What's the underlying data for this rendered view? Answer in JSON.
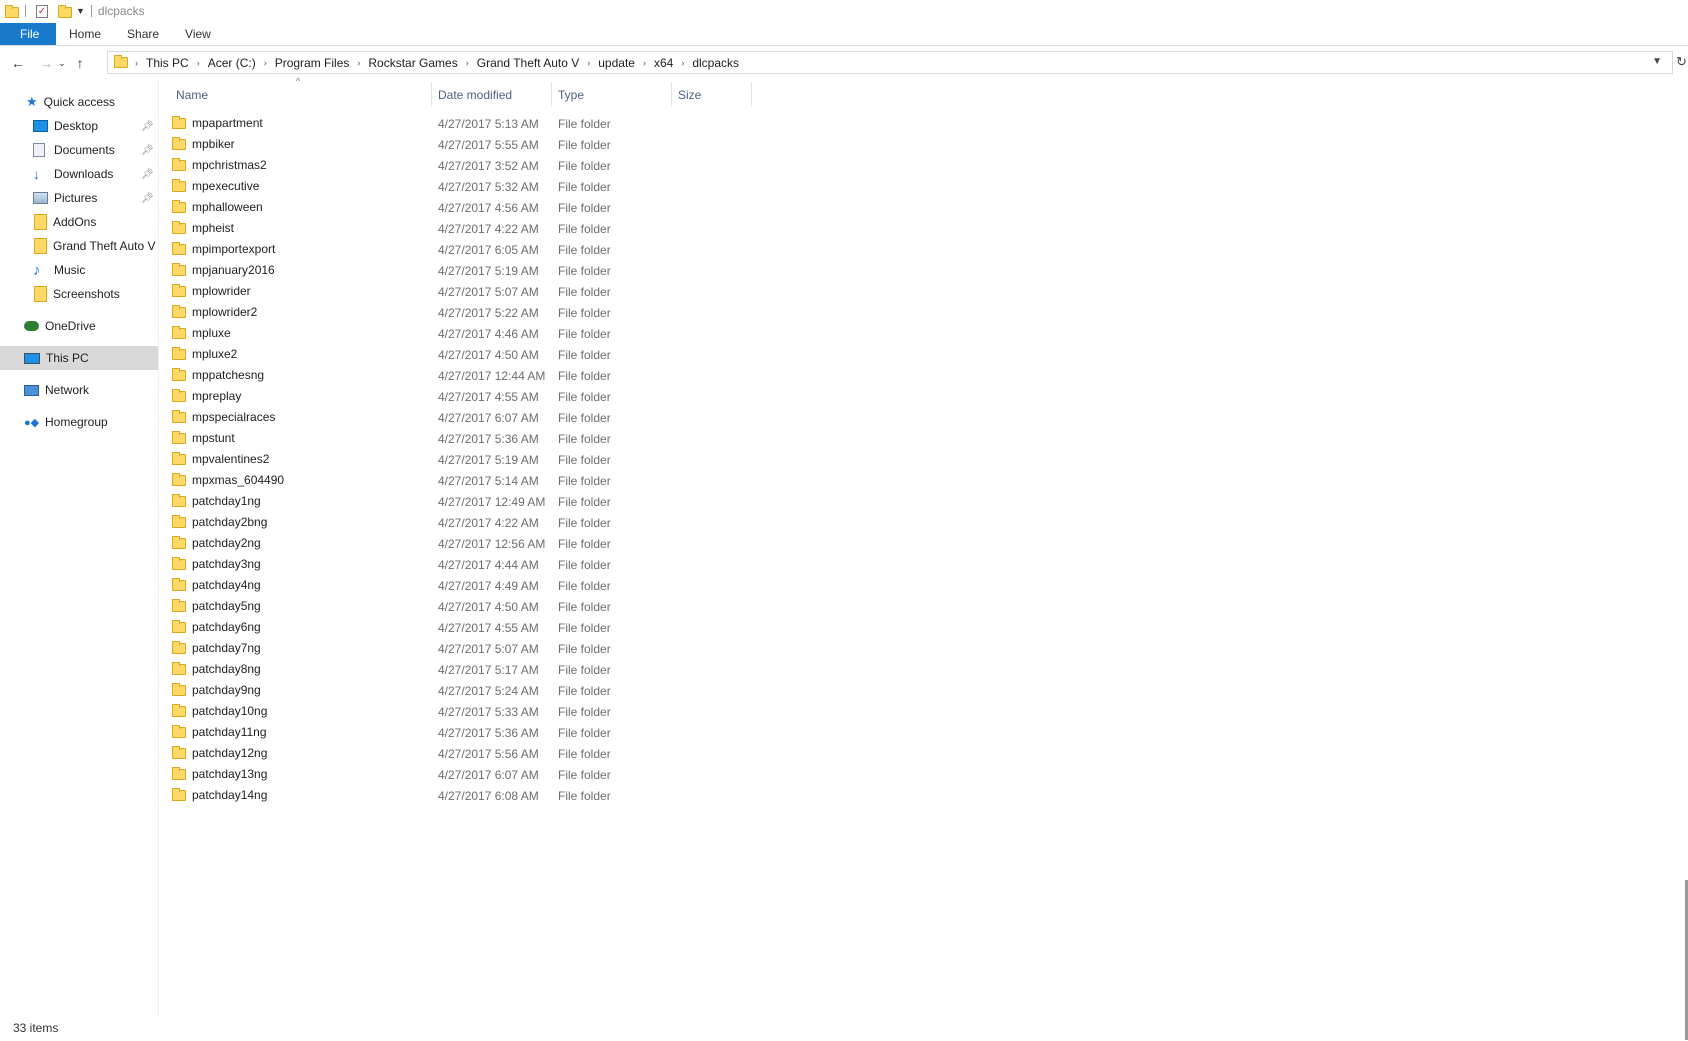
{
  "window": {
    "title": "dlcpacks",
    "quick_access_toolbar": [
      "folder-icon",
      "properties-icon",
      "new-folder-icon",
      "customize-dropdown-icon"
    ]
  },
  "ribbon": {
    "tabs": [
      {
        "label": "File",
        "active": true
      },
      {
        "label": "Home"
      },
      {
        "label": "Share"
      },
      {
        "label": "View"
      }
    ]
  },
  "address": {
    "crumbs": [
      "This PC",
      "Acer (C:)",
      "Program Files",
      "Rockstar Games",
      "Grand Theft Auto V",
      "update",
      "x64",
      "dlcpacks"
    ]
  },
  "nav": {
    "items": [
      {
        "label": "Quick access",
        "icon": "star-icon",
        "pinned": false
      },
      {
        "label": "Desktop",
        "icon": "desktop-icon",
        "pinned": true
      },
      {
        "label": "Documents",
        "icon": "documents-icon",
        "pinned": true
      },
      {
        "label": "Downloads",
        "icon": "downloads-icon",
        "pinned": true
      },
      {
        "label": "Pictures",
        "icon": "pictures-icon",
        "pinned": true
      },
      {
        "label": "AddOns",
        "icon": "folder-icon",
        "pinned": false
      },
      {
        "label": "Grand Theft Auto V",
        "icon": "folder-icon",
        "pinned": false
      },
      {
        "label": "Music",
        "icon": "music-icon",
        "pinned": false
      },
      {
        "label": "Screenshots",
        "icon": "folder-icon",
        "pinned": false
      },
      {
        "label": "OneDrive",
        "icon": "onedrive-icon",
        "pinned": false
      },
      {
        "label": "This PC",
        "icon": "computer-icon",
        "pinned": false,
        "selected": true
      },
      {
        "label": "Network",
        "icon": "network-icon",
        "pinned": false
      },
      {
        "label": "Homegroup",
        "icon": "homegroup-icon",
        "pinned": false
      }
    ]
  },
  "columns": {
    "name": "Name",
    "date": "Date modified",
    "type": "Type",
    "size": "Size"
  },
  "files": [
    {
      "name": "mpapartment",
      "date": "4/27/2017 5:13 AM",
      "type": "File folder"
    },
    {
      "name": "mpbiker",
      "date": "4/27/2017 5:55 AM",
      "type": "File folder"
    },
    {
      "name": "mpchristmas2",
      "date": "4/27/2017 3:52 AM",
      "type": "File folder"
    },
    {
      "name": "mpexecutive",
      "date": "4/27/2017 5:32 AM",
      "type": "File folder"
    },
    {
      "name": "mphalloween",
      "date": "4/27/2017 4:56 AM",
      "type": "File folder"
    },
    {
      "name": "mpheist",
      "date": "4/27/2017 4:22 AM",
      "type": "File folder"
    },
    {
      "name": "mpimportexport",
      "date": "4/27/2017 6:05 AM",
      "type": "File folder"
    },
    {
      "name": "mpjanuary2016",
      "date": "4/27/2017 5:19 AM",
      "type": "File folder"
    },
    {
      "name": "mplowrider",
      "date": "4/27/2017 5:07 AM",
      "type": "File folder"
    },
    {
      "name": "mplowrider2",
      "date": "4/27/2017 5:22 AM",
      "type": "File folder"
    },
    {
      "name": "mpluxe",
      "date": "4/27/2017 4:46 AM",
      "type": "File folder"
    },
    {
      "name": "mpluxe2",
      "date": "4/27/2017 4:50 AM",
      "type": "File folder"
    },
    {
      "name": "mppatchesng",
      "date": "4/27/2017 12:44 AM",
      "type": "File folder"
    },
    {
      "name": "mpreplay",
      "date": "4/27/2017 4:55 AM",
      "type": "File folder"
    },
    {
      "name": "mpspecialraces",
      "date": "4/27/2017 6:07 AM",
      "type": "File folder"
    },
    {
      "name": "mpstunt",
      "date": "4/27/2017 5:36 AM",
      "type": "File folder"
    },
    {
      "name": "mpvalentines2",
      "date": "4/27/2017 5:19 AM",
      "type": "File folder"
    },
    {
      "name": "mpxmas_604490",
      "date": "4/27/2017 5:14 AM",
      "type": "File folder"
    },
    {
      "name": "patchday1ng",
      "date": "4/27/2017 12:49 AM",
      "type": "File folder"
    },
    {
      "name": "patchday2bng",
      "date": "4/27/2017 4:22 AM",
      "type": "File folder"
    },
    {
      "name": "patchday2ng",
      "date": "4/27/2017 12:56 AM",
      "type": "File folder"
    },
    {
      "name": "patchday3ng",
      "date": "4/27/2017 4:44 AM",
      "type": "File folder"
    },
    {
      "name": "patchday4ng",
      "date": "4/27/2017 4:49 AM",
      "type": "File folder"
    },
    {
      "name": "patchday5ng",
      "date": "4/27/2017 4:50 AM",
      "type": "File folder"
    },
    {
      "name": "patchday6ng",
      "date": "4/27/2017 4:55 AM",
      "type": "File folder"
    },
    {
      "name": "patchday7ng",
      "date": "4/27/2017 5:07 AM",
      "type": "File folder"
    },
    {
      "name": "patchday8ng",
      "date": "4/27/2017 5:17 AM",
      "type": "File folder"
    },
    {
      "name": "patchday9ng",
      "date": "4/27/2017 5:24 AM",
      "type": "File folder"
    },
    {
      "name": "patchday10ng",
      "date": "4/27/2017 5:33 AM",
      "type": "File folder"
    },
    {
      "name": "patchday11ng",
      "date": "4/27/2017 5:36 AM",
      "type": "File folder"
    },
    {
      "name": "patchday12ng",
      "date": "4/27/2017 5:56 AM",
      "type": "File folder"
    },
    {
      "name": "patchday13ng",
      "date": "4/27/2017 6:07 AM",
      "type": "File folder"
    },
    {
      "name": "patchday14ng",
      "date": "4/27/2017 6:08 AM",
      "type": "File folder"
    }
  ],
  "status": {
    "item_count": "33 items"
  },
  "colors": {
    "file_tab": "#1979ca",
    "folder": "#ffd966",
    "header_text": "#4d6082",
    "selected": "#d9d9d9"
  }
}
